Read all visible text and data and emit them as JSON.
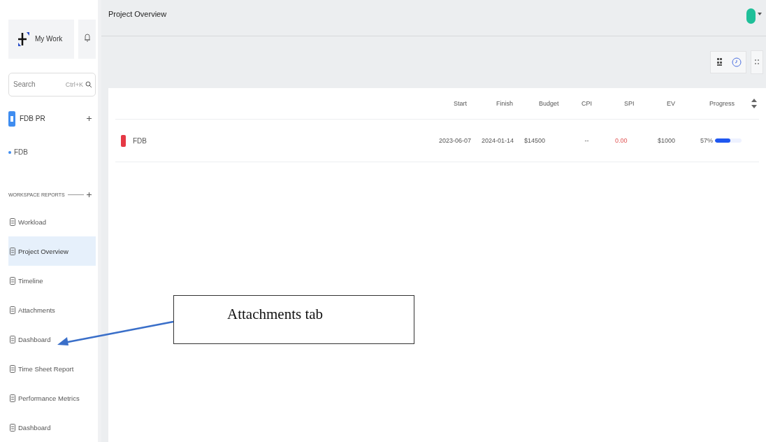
{
  "sidebar": {
    "home_label": "My Work",
    "search": {
      "placeholder": "Search",
      "shortcut": "Ctrl+K"
    },
    "project": {
      "name": "FDB PR",
      "children": [
        {
          "name": "FDB"
        }
      ]
    },
    "section_title": "WORKSPACE REPORTS",
    "items": [
      {
        "label": "Workload",
        "selected": false
      },
      {
        "label": "Project Overview",
        "selected": true
      },
      {
        "label": "Timeline",
        "selected": false
      },
      {
        "label": "Attachments",
        "selected": false
      },
      {
        "label": "Dashboard",
        "selected": false
      },
      {
        "label": "Time Sheet Report",
        "selected": false
      },
      {
        "label": "Performance Metrics",
        "selected": false
      },
      {
        "label": "Dashboard",
        "selected": false
      }
    ]
  },
  "header": {
    "title": "Project Overview"
  },
  "table": {
    "columns": [
      "Start",
      "Finish",
      "Budget",
      "CPI",
      "SPI",
      "EV",
      "Progress"
    ],
    "rows": [
      {
        "name": "FDB",
        "color": "#e53945",
        "start": "2023-06-07",
        "finish": "2024-01-14",
        "budget": "$14500",
        "cpi": "--",
        "spi": "0.00",
        "ev": "$1000",
        "progress": "57%",
        "level": 0.57
      }
    ]
  },
  "callout": {
    "text": "Attachments tab"
  }
}
